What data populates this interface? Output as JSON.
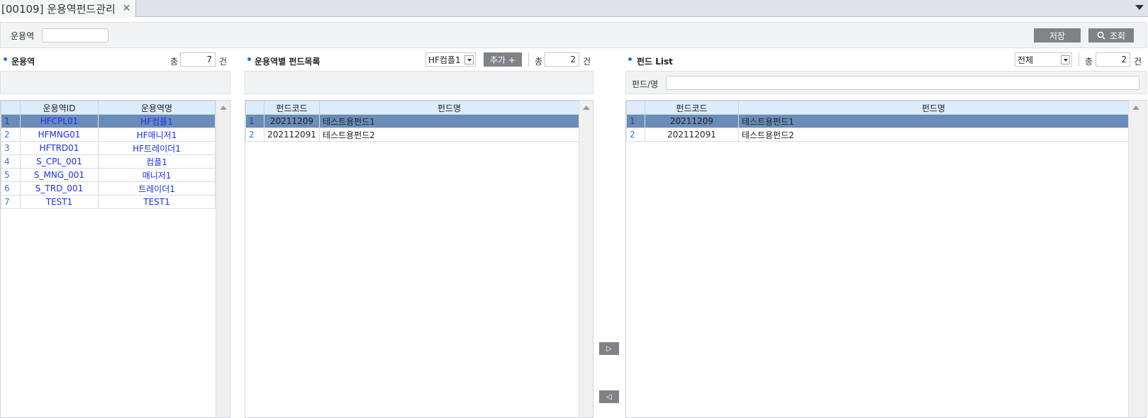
{
  "tab": {
    "title": "[00109] 운용역펀드관리",
    "close": "✕"
  },
  "search": {
    "label": "운용역",
    "value": "",
    "save_label": "저장",
    "query_label": "조회"
  },
  "left": {
    "title": "운용역",
    "total_label": "총",
    "count": "7",
    "unit": "건",
    "columns": [
      "운용역ID",
      "운용역명"
    ],
    "rows": [
      {
        "n": "1",
        "id": "HFCPL01",
        "name": "HF컴플1"
      },
      {
        "n": "2",
        "id": "HFMNG01",
        "name": "HF매니저1"
      },
      {
        "n": "3",
        "id": "HFTRD01",
        "name": "HF트레이더1"
      },
      {
        "n": "4",
        "id": "S_CPL_001",
        "name": "컴플1"
      },
      {
        "n": "5",
        "id": "S_MNG_001",
        "name": "매니저1"
      },
      {
        "n": "6",
        "id": "S_TRD_001",
        "name": "트레이더1"
      },
      {
        "n": "7",
        "id": "TEST1",
        "name": "TEST1"
      }
    ]
  },
  "middle": {
    "title": "운용역별 펀드목록",
    "select_value": "HF컴플1",
    "add_label": "추가 +",
    "total_label": "총",
    "count": "2",
    "unit": "건",
    "columns": [
      "펀드코드",
      "펀드명"
    ],
    "rows": [
      {
        "n": "1",
        "code": "20211209",
        "name": "테스트용펀드1"
      },
      {
        "n": "2",
        "code": "202112091",
        "name": "테스트용펀드2"
      }
    ]
  },
  "transfer": {
    "right": "▷",
    "left": "◁"
  },
  "right": {
    "title": "펀드 List",
    "select_value": "전체",
    "total_label": "총",
    "count": "2",
    "unit": "건",
    "filter_label": "펀드/명",
    "filter_value": "",
    "columns": [
      "펀드코드",
      "펀드명"
    ],
    "rows": [
      {
        "n": "1",
        "code": "20211209",
        "name": "테스트용펀드1"
      },
      {
        "n": "2",
        "code": "202112091",
        "name": "테스트용펀드2"
      }
    ]
  }
}
